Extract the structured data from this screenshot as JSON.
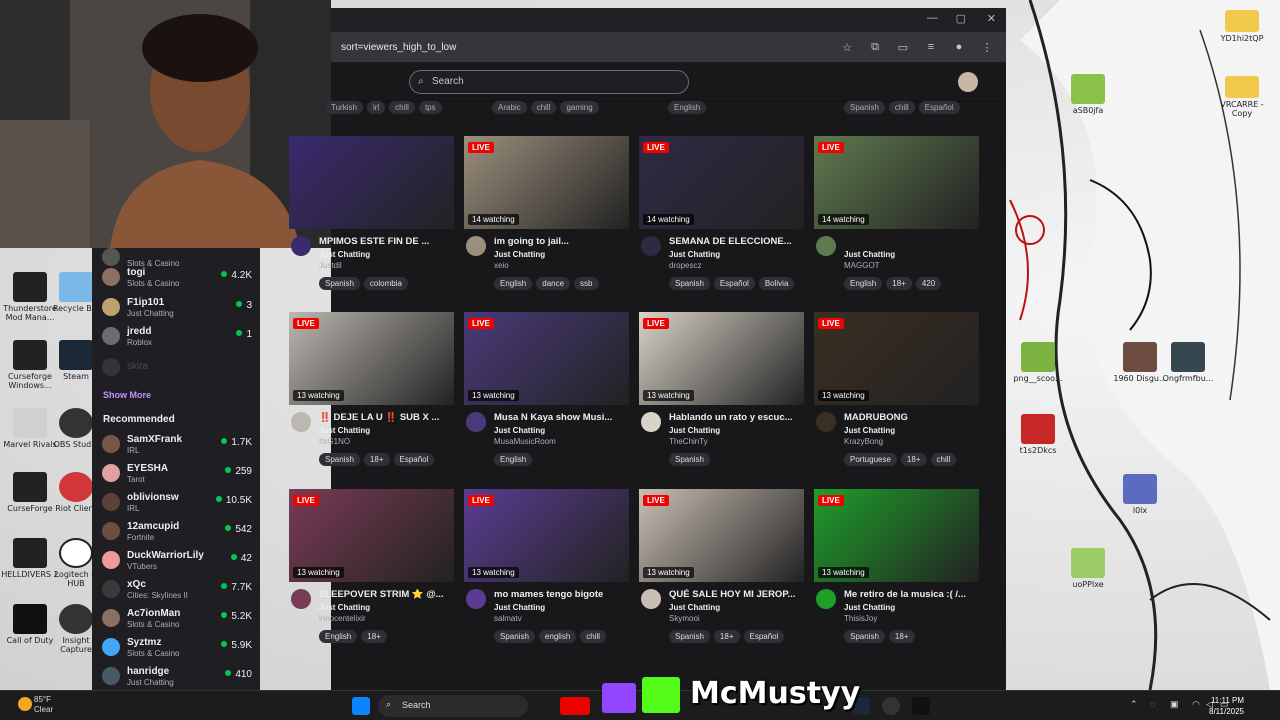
{
  "browser": {
    "url": "sort=viewers_high_to_low",
    "search_placeholder": "Search"
  },
  "top_tags": [
    [
      "Turkish",
      "irl",
      "chill",
      "tps"
    ],
    [
      "Arabic",
      "chill",
      "gaming"
    ],
    [
      "English"
    ],
    [
      "Spanish",
      "chill",
      "Español"
    ]
  ],
  "sidebar": {
    "items": [
      {
        "name": "",
        "category": "Slots & Casino",
        "count": ""
      },
      {
        "name": "togi",
        "category": "Slots & Casino",
        "count": "4.2K"
      },
      {
        "name": "F1ip101",
        "category": "Just Chatting",
        "count": "3"
      },
      {
        "name": "jredd",
        "category": "Roblox",
        "count": "1"
      },
      {
        "name": "skira",
        "category": "",
        "count": ""
      }
    ],
    "show_more": "Show More",
    "recommended_title": "Recommended",
    "recommended": [
      {
        "name": "SamXFrank",
        "category": "IRL",
        "count": "1.7K"
      },
      {
        "name": "EYESHA",
        "category": "Tarot",
        "count": "259"
      },
      {
        "name": "oblivionsw",
        "category": "IRL",
        "count": "10.5K"
      },
      {
        "name": "12amcupid",
        "category": "Fortnite",
        "count": "542"
      },
      {
        "name": "DuckWarriorLily",
        "category": "VTubers",
        "count": "42"
      },
      {
        "name": "xQc",
        "category": "Cities: Skylines II",
        "count": "7.7K"
      },
      {
        "name": "Ac7ionMan",
        "category": "Slots & Casino",
        "count": "5.2K"
      },
      {
        "name": "Syztmz",
        "category": "Slots & Casino",
        "count": "5.9K"
      },
      {
        "name": "hanridge",
        "category": "Just Chatting",
        "count": "410"
      }
    ]
  },
  "streams": [
    {
      "title": "MPIMOS ESTE FIN DE ...",
      "category": "Just Chatting",
      "channel": "Justdil",
      "tags": [
        "Spanish",
        "colombia"
      ],
      "watching": "",
      "live": false,
      "color": "#3a2a6e"
    },
    {
      "title": "im going to jail...",
      "category": "Just Chatting",
      "channel": "xeio",
      "tags": [
        "English",
        "dance",
        "ssb"
      ],
      "watching": "14 watching",
      "live": true,
      "color": "#9c8f7d"
    },
    {
      "title": "SEMANA DE ELECCIONE...",
      "category": "Just Chatting",
      "channel": "dropescz",
      "tags": [
        "Spanish",
        "Español",
        "Bolivia"
      ],
      "watching": "14 watching",
      "live": true,
      "color": "#2e2a45"
    },
    {
      "title": "",
      "category": "Just Chatting",
      "channel": "MAGGOT",
      "tags": [
        "English",
        "18+",
        "420"
      ],
      "watching": "14 watching",
      "live": true,
      "color": "#5f7a4e"
    },
    {
      "title": "‼️ DEJE LA U ‼️ SUB X ...",
      "category": "Just Chatting",
      "channel": "ItsG1NO",
      "tags": [
        "Spanish",
        "18+",
        "Español"
      ],
      "watching": "13 watching",
      "live": true,
      "color": "#bcb7b0"
    },
    {
      "title": "Musa N Kaya show Musi...",
      "category": "Just Chatting",
      "channel": "MusaMusicRoom",
      "tags": [
        "English"
      ],
      "watching": "13 watching",
      "live": true,
      "color": "#4a3a7a"
    },
    {
      "title": "Hablando un rato y escuc...",
      "category": "Just Chatting",
      "channel": "TheChinTy",
      "tags": [
        "Spanish"
      ],
      "watching": "13 watching",
      "live": true,
      "color": "#d9d3c9"
    },
    {
      "title": "MADRUBONG",
      "category": "Just Chatting",
      "channel": "KrazyBong",
      "tags": [
        "Portuguese",
        "18+",
        "chill"
      ],
      "watching": "13 watching",
      "live": true,
      "color": "#3b2e22"
    },
    {
      "title": "SLEEPOVER STRIM ⭐ @...",
      "category": "Just Chatting",
      "channel": "innocentelixir",
      "tags": [
        "English",
        "18+"
      ],
      "watching": "13 watching",
      "live": true,
      "color": "#7a3b55"
    },
    {
      "title": "mo mames tengo bigote",
      "category": "Just Chatting",
      "channel": "salmatv",
      "tags": [
        "Spanish",
        "english",
        "chill"
      ],
      "watching": "13 watching",
      "live": true,
      "color": "#5a3d92"
    },
    {
      "title": "QUÉ SALE HOY MI JEROP...",
      "category": "Just Chatting",
      "channel": "Skymooi",
      "tags": [
        "Spanish",
        "18+",
        "Español"
      ],
      "watching": "13 watching",
      "live": true,
      "color": "#c9bfb4"
    },
    {
      "title": "Me retiro de la musica :( /...",
      "category": "Just Chatting",
      "channel": "ThisisJoy",
      "tags": [
        "Spanish",
        "18+"
      ],
      "watching": "13 watching",
      "live": true,
      "color": "#1f9e2a"
    }
  ],
  "live_label": "LIVE",
  "desktop_icons": [
    "YD1hi2tQP",
    "aSB0jfa",
    "VRCARRE - Copy",
    "Thunderstore Mod Mana...",
    "Recycle Bin",
    "Curseforge Windows...",
    "Steam",
    "Marvel Rivals",
    "OBS Studio",
    "CurseForge",
    "Riot Client",
    "HELLDIVERS 2",
    "Logitech G HUB",
    "Call of Duty",
    "Insight Capture",
    "png__scoo...",
    "1960 Disgu...",
    "Ongfrmfbu...",
    "t1s2Dkcs",
    "l0lx",
    "uoPPlxe"
  ],
  "taskbar": {
    "temp": "85°F",
    "weather": "Clear",
    "search": "Search",
    "time": "11:11 PM",
    "date": "8/11/2025"
  },
  "overlay": {
    "streamer": "McMustyy"
  }
}
